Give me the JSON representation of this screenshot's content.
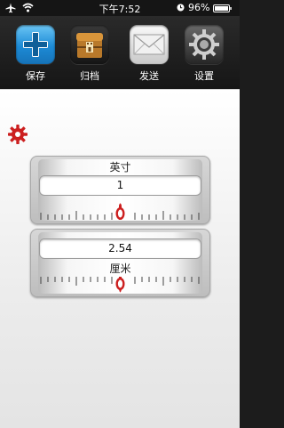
{
  "status_bar": {
    "time": "下午7:52",
    "battery": "96%"
  },
  "toolbar": {
    "items": [
      {
        "label": "保存",
        "icon": "plus-icon"
      },
      {
        "label": "归档",
        "icon": "archive-chest-icon"
      },
      {
        "label": "发送",
        "icon": "envelope-icon"
      },
      {
        "label": "设置",
        "icon": "gear-icon"
      }
    ]
  },
  "converter": {
    "top": {
      "unit": "英寸",
      "value": "1"
    },
    "bottom": {
      "unit": "厘米",
      "value": "2.54"
    }
  },
  "colors": {
    "accent_red": "#cc1f1f",
    "save_blue": "#2b9fe3"
  }
}
